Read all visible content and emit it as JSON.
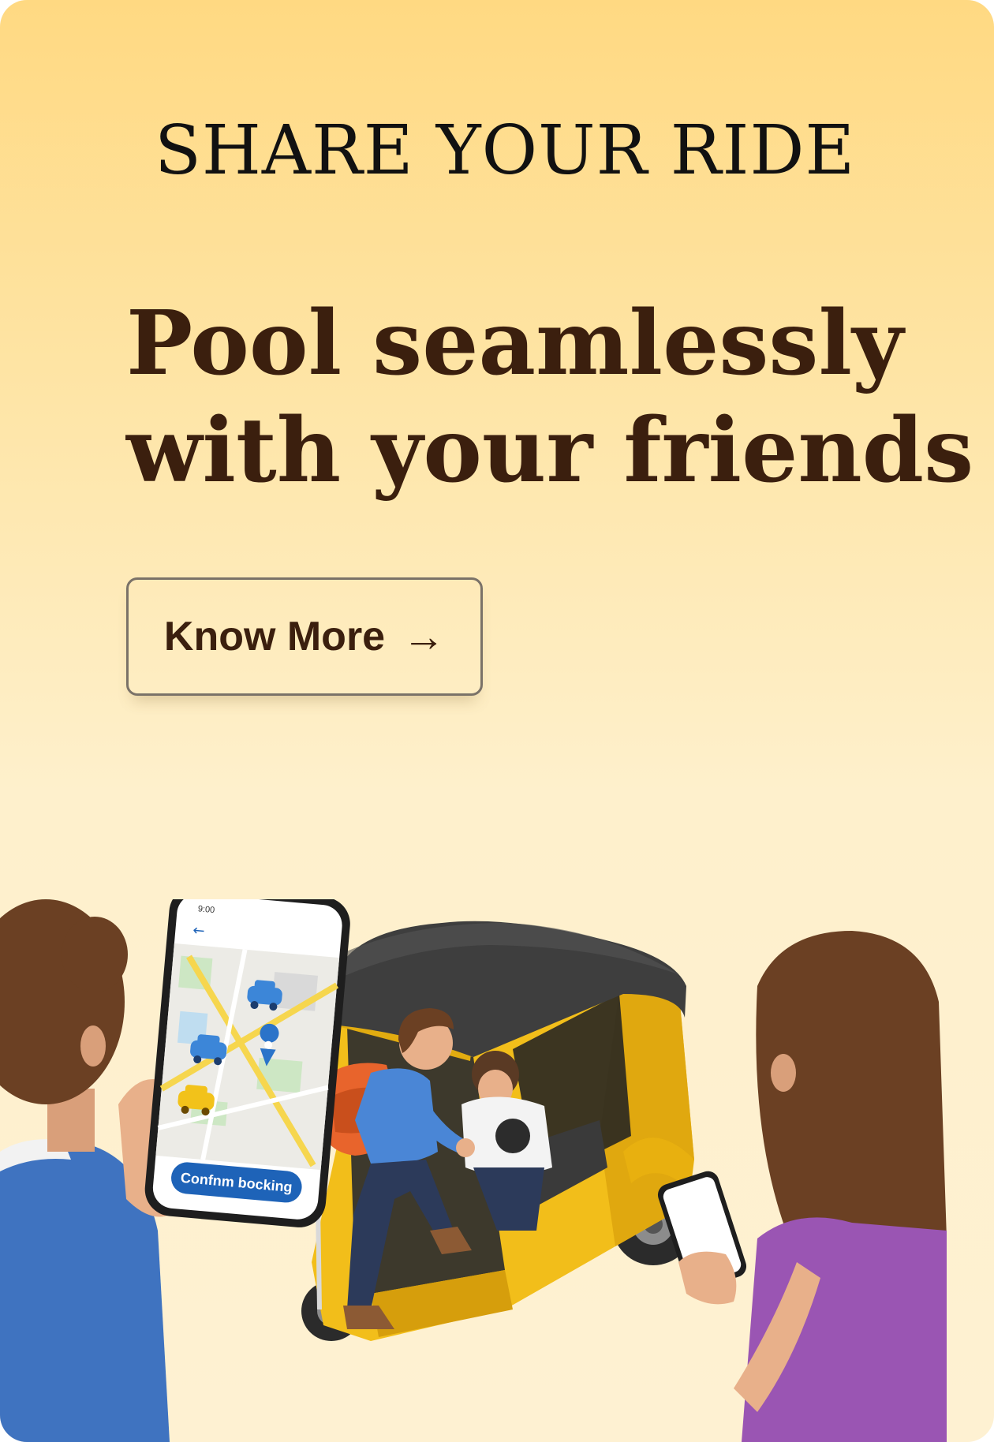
{
  "banner": {
    "eyebrow": "SHARE YOUR RIDE",
    "headline_line1": "Pool seamlessly",
    "headline_line2": "with your friends",
    "cta_label": "Know More",
    "cta_icon": "arrow-right-icon"
  },
  "illustration": {
    "phone_time": "9:00",
    "phone_button_label": "Confnm bocking"
  },
  "colors": {
    "gradient_top": "#FFD982",
    "gradient_bottom": "#FEF1D2",
    "headline": "#3B1F0E",
    "rickshaw_yellow": "#F2BE1A",
    "rickshaw_roof": "#3E3E3E",
    "phone_button": "#1E63B8"
  }
}
